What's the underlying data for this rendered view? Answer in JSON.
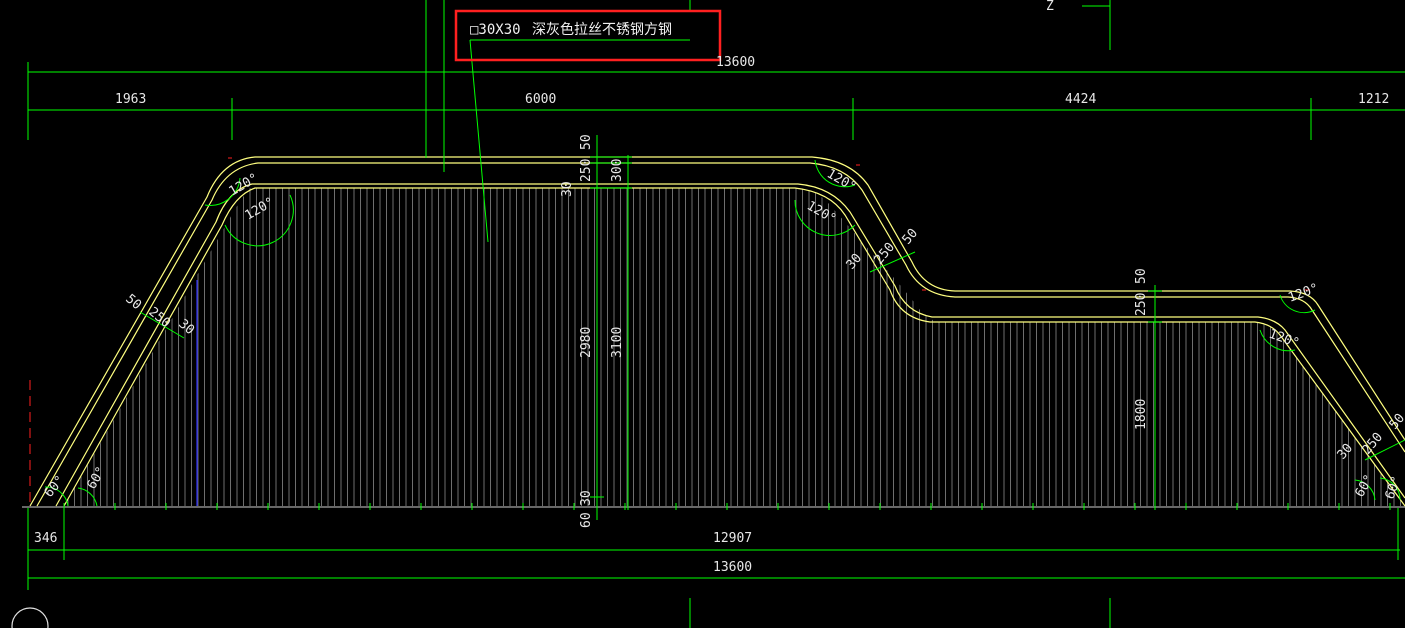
{
  "note": {
    "section_label": "□30X30",
    "material_label": "深灰色拉丝不锈钢方钢"
  },
  "top_dims": {
    "overall": "13600",
    "seg1": "1963",
    "seg2": "6000",
    "seg3": "4424",
    "seg4": "1212"
  },
  "bottom_dims": {
    "left_offset": "346",
    "inner": "12907",
    "overall": "13600"
  },
  "vertical_dims": {
    "mid_50": "50",
    "mid_250": "250",
    "mid_300": "300",
    "mid_30_top": "30",
    "mid_2980": "2980",
    "mid_3100": "3100",
    "mid_30_bottom": "30",
    "mid_60": "60",
    "right_50": "50",
    "right_250": "250",
    "right_1800": "1800"
  },
  "slope_dims": {
    "left_50": "50",
    "left_250": "250",
    "left_30": "30",
    "mid_30": "30",
    "mid_250": "250",
    "mid_50": "50",
    "right_30": "30",
    "right_250": "250",
    "right_50": "50"
  },
  "angles": {
    "a120_1": "120°",
    "a120_2": "120°",
    "a120_3": "120°",
    "a120_4": "120°",
    "a120_5": "120°",
    "a120_6": "120°",
    "a60_1": "60°",
    "a60_2": "60°",
    "a60_3": "60°",
    "a60_4": "60°"
  },
  "misc": {
    "z_mark": "Z"
  },
  "colors": {
    "background": "#000000",
    "dimension": "#00ff00",
    "outline": "#ffff80",
    "hatch": "#9a9a9a",
    "highlight": "#ff2020",
    "blue_line": "#3030ff"
  }
}
